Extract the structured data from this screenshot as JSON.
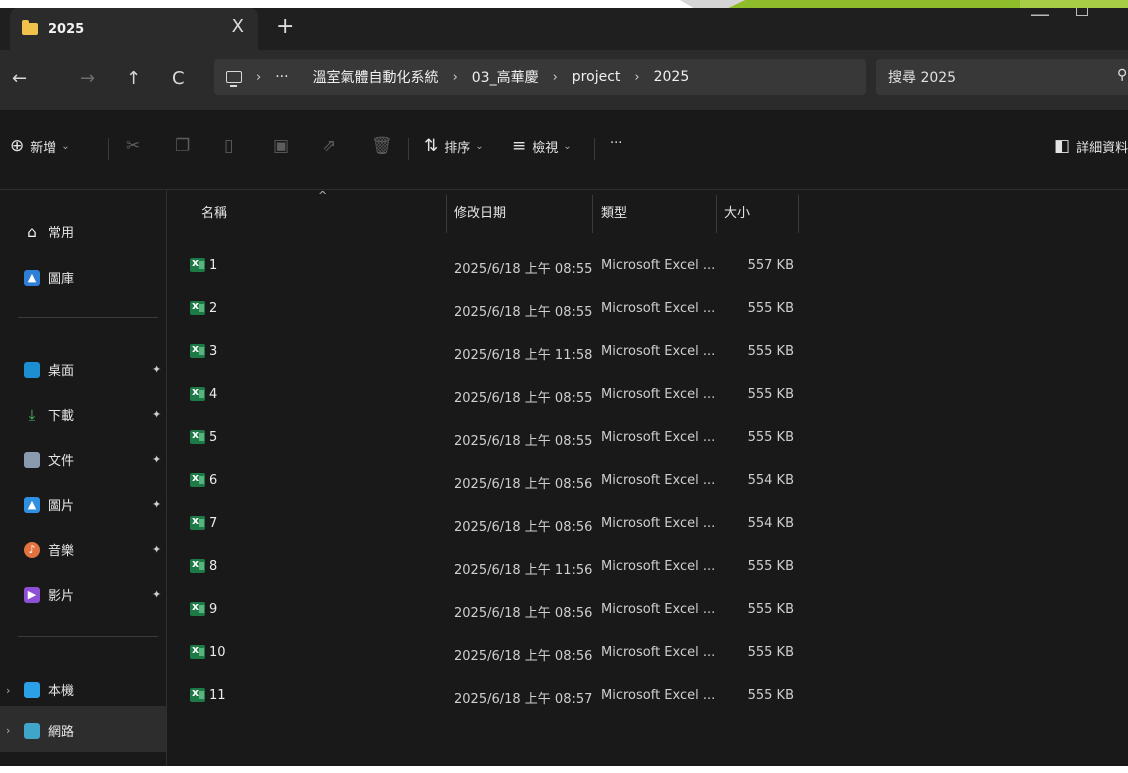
{
  "colors": {
    "window_bg": "#191919",
    "accent_green": "#8fbc2a",
    "folder": "#f0c24b",
    "excel": "#1d7a46"
  },
  "tab": {
    "title": "2025",
    "close": "X",
    "new": "+"
  },
  "window_controls": {
    "minimize": "—"
  },
  "nav": {
    "back": "←",
    "forward": "→",
    "up": "↑",
    "refresh": "C"
  },
  "address": {
    "overflow": "···",
    "segments": [
      "溫室氣體自動化系統",
      "03_高華慶",
      "project",
      "2025"
    ],
    "separator": "›"
  },
  "search": {
    "placeholder": "搜尋 2025",
    "icon": "search-icon"
  },
  "toolbar": {
    "new_label": "新增",
    "sort_label": "排序",
    "view_label": "檢視",
    "more_label": "···",
    "details_label": "詳細資料"
  },
  "sidebar": {
    "home": "常用",
    "gallery": "圖庫",
    "desktop": "桌面",
    "downloads": "下載",
    "documents": "文件",
    "pictures": "圖片",
    "music": "音樂",
    "videos": "影片",
    "thispc": "本機",
    "network": "網路"
  },
  "columns": {
    "name": "名稱",
    "modified": "修改日期",
    "type": "類型",
    "size": "大小"
  },
  "files": [
    {
      "name": "1",
      "modified": "2025/6/18 上午 08:55",
      "type": "Microsoft Excel ...",
      "size": "557 KB"
    },
    {
      "name": "2",
      "modified": "2025/6/18 上午 08:55",
      "type": "Microsoft Excel ...",
      "size": "555 KB"
    },
    {
      "name": "3",
      "modified": "2025/6/18 上午 11:58",
      "type": "Microsoft Excel ...",
      "size": "555 KB"
    },
    {
      "name": "4",
      "modified": "2025/6/18 上午 08:55",
      "type": "Microsoft Excel ...",
      "size": "555 KB"
    },
    {
      "name": "5",
      "modified": "2025/6/18 上午 08:55",
      "type": "Microsoft Excel ...",
      "size": "555 KB"
    },
    {
      "name": "6",
      "modified": "2025/6/18 上午 08:56",
      "type": "Microsoft Excel ...",
      "size": "554 KB"
    },
    {
      "name": "7",
      "modified": "2025/6/18 上午 08:56",
      "type": "Microsoft Excel ...",
      "size": "554 KB"
    },
    {
      "name": "8",
      "modified": "2025/6/18 上午 11:56",
      "type": "Microsoft Excel ...",
      "size": "555 KB"
    },
    {
      "name": "9",
      "modified": "2025/6/18 上午 08:56",
      "type": "Microsoft Excel ...",
      "size": "555 KB"
    },
    {
      "name": "10",
      "modified": "2025/6/18 上午 08:56",
      "type": "Microsoft Excel ...",
      "size": "555 KB"
    },
    {
      "name": "11",
      "modified": "2025/6/18 上午 08:57",
      "type": "Microsoft Excel ...",
      "size": "555 KB"
    }
  ]
}
